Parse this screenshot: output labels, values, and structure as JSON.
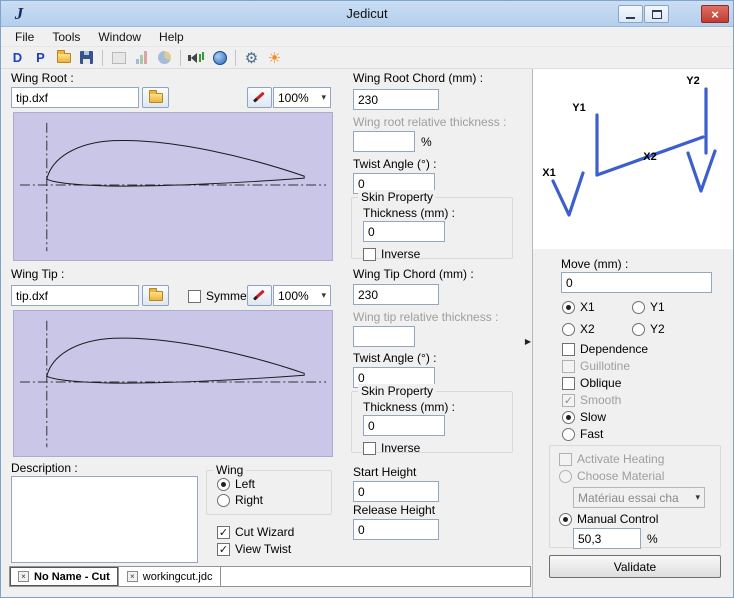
{
  "window": {
    "title": "Jedicut"
  },
  "menubar": {
    "items": [
      "File",
      "Tools",
      "Window",
      "Help"
    ]
  },
  "toolbar": {
    "dxf_label": "D",
    "plt_label": "P",
    "icon_names": [
      "dxf-import-icon",
      "plt-import-icon",
      "open-file-icon",
      "save-icon",
      "machine-icon",
      "chart-icon",
      "material-icon",
      "sound-icon",
      "language-globe-icon",
      "settings-gear-icon",
      "heating-sun-icon"
    ]
  },
  "icons": {
    "close_glyph": "×",
    "tab_close_glyph": "×",
    "check_glyph": "✓",
    "dropdown_arrow_glyph": "▾",
    "panel_toggle_glyph": "▶",
    "gear_glyph": "⚙",
    "sun_glyph": "☀"
  },
  "left": {
    "wing_root_label": "Wing Root :",
    "wing_root_file": "tip.dxf",
    "wing_root_zoom": "100%",
    "wing_tip_label": "Wing Tip :",
    "wing_tip_file": "tip.dxf",
    "symmetrical_label": "Symmetrical pr",
    "wing_tip_zoom": "100%",
    "description_label": "Description :",
    "description_value": "",
    "wing_group": {
      "title": "Wing",
      "left_label": "Left",
      "right_label": "Right"
    },
    "cut_wizard_label": "Cut Wizard",
    "view_twist_label": "View Twist"
  },
  "center": {
    "root": {
      "chord_label": "Wing Root Chord (mm) :",
      "chord_value": "230",
      "thickness_label": "Wing root relative thickness :",
      "thickness_value": "",
      "percent": "%",
      "twist_label": "Twist Angle (°) :",
      "twist_value": "0",
      "skin": {
        "title": "Skin Property",
        "thickness_label": "Thickness (mm) :",
        "thickness_value": "0",
        "inverse_label": "Inverse"
      }
    },
    "tip": {
      "chord_label": "Wing Tip Chord (mm) :",
      "chord_value": "230",
      "thickness_label": "Wing tip relative thickness :",
      "thickness_value": "",
      "twist_label": "Twist Angle (°) :",
      "twist_value": "0",
      "skin": {
        "title": "Skin Property",
        "thickness_label": "Thickness (mm) :",
        "thickness_value": "0",
        "inverse_label": "Inverse"
      }
    },
    "start_height_label": "Start Height",
    "start_height_value": "0",
    "release_height_label": "Release Height",
    "release_height_value": "0"
  },
  "right": {
    "axis_labels": {
      "x1": "X1",
      "y1": "Y1",
      "x2": "X2",
      "y2": "Y2"
    },
    "move_label": "Move (mm) :",
    "move_value": "0",
    "axis_options": [
      "X1",
      "Y1",
      "X2",
      "Y2"
    ],
    "dependence_label": "Dependence",
    "guillotine_label": "Guillotine",
    "oblique_label": "Oblique",
    "smooth_label": "Smooth",
    "slow_label": "Slow",
    "fast_label": "Fast",
    "heating": {
      "activate_label": "Activate Heating",
      "choose_label": "Choose Material",
      "material_value": "Matériau essai cha",
      "manual_label": "Manual Control",
      "percent_value": "50,3",
      "percent": "%"
    },
    "validate_label": "Validate"
  },
  "tabs": {
    "items": [
      "No Name - Cut",
      "workingcut.jdc"
    ]
  },
  "colors": {
    "titlebar": "#bcd4ee",
    "close_button": "#c23b30",
    "preview_bg": "#c9c6e8",
    "diagram_line": "#3c5ecf",
    "accent_blue": "#1e3fbf"
  }
}
